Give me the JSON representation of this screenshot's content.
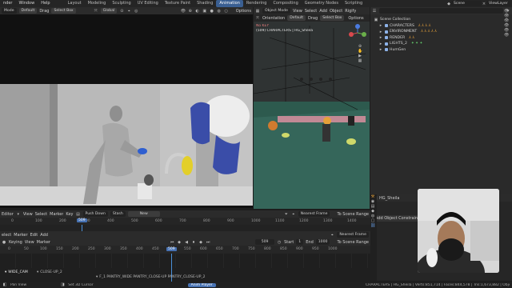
{
  "topbar": {
    "menus": [
      "nder",
      "Window",
      "Help"
    ],
    "workspaces": [
      "Layout",
      "Modeling",
      "Sculpting",
      "UV Editing",
      "Texture Paint",
      "Shading",
      "Animation",
      "Rendering",
      "Compositing",
      "Geometry Nodes",
      "Scripting"
    ],
    "active_workspace": "Animation",
    "scene_label": "Scene",
    "viewlayer_label": "ViewLayer"
  },
  "left_viewport": {
    "mode": "Mode",
    "orientation": "Default",
    "drag": "Drag",
    "select": "Select Box",
    "global": "Global",
    "options": "Options"
  },
  "right_viewport": {
    "mode": "Object Mode",
    "menus": [
      "View",
      "Select",
      "Add",
      "Object",
      "Rigify"
    ],
    "orientation_label": "Orientation",
    "orientation": "Default",
    "drag": "Drag",
    "select": "Select Box",
    "options": "Options",
    "overlay_line1": "No KEY",
    "overlay_line2": "(509) CHARACTERS | HG_Sheila"
  },
  "outliner": {
    "title": "Scene Collection",
    "items": [
      "CHARACTERS",
      "ENVIRONMENT",
      "RENDER",
      "LIGHTS_2",
      "HumGen"
    ]
  },
  "properties": {
    "object_name": "HG_Sheila",
    "constraint_button": "Add Object Constraint"
  },
  "timeline": {
    "header1": {
      "editor": "Editor",
      "menus": [
        "View",
        "Select",
        "Marker",
        "Key"
      ],
      "push_down": "Push Down",
      "stash": "Stash",
      "new": "New",
      "snap": "Nearest Frame",
      "scene_range": "To Scene Range"
    },
    "ruler1_ticks": [
      "0",
      "100",
      "200",
      "300",
      "400",
      "500",
      "600",
      "700",
      "800",
      "900",
      "1000",
      "1100",
      "1200",
      "1300",
      "1400"
    ],
    "ruler1_frame": "509",
    "header2": {
      "menus": [
        "elect",
        "Marker",
        "Edit",
        "Add"
      ],
      "snap": "Nearest Frame"
    },
    "header3": {
      "keying": "Keying",
      "menus": [
        "View",
        "Marker"
      ],
      "current_frame": "509",
      "start_label": "Start",
      "start_value": "1",
      "end_label": "End",
      "end_value": "1000",
      "scene_range": "To Scene Range"
    },
    "ruler2_ticks": [
      "0",
      "50",
      "100",
      "150",
      "200",
      "250",
      "300",
      "350",
      "400",
      "450",
      "500",
      "550",
      "600",
      "650",
      "700",
      "750",
      "800",
      "850",
      "900",
      "950",
      "1000"
    ],
    "ruler2_frame": "509",
    "markers": [
      "WIDE_CAM",
      "CLOSE-UP_2",
      "F_1 PANTRY_WIDE PANTRY_CLOSE-UP PANTRY_CLOSE-UP_2"
    ]
  },
  "statusbar": {
    "left1": "Pan View",
    "left2": "Set 3D Cursor",
    "center": "Anim Player",
    "right": "CHARACTERS | HG_Sheila | Verts:851,714 | Faces:844,578 | Tris:1,673,882 | Objects:1/165 | Memo"
  },
  "colors": {
    "accent": "#4772b3",
    "orange": "#e6a13a",
    "viewport_floor": "#2d5a4e"
  }
}
